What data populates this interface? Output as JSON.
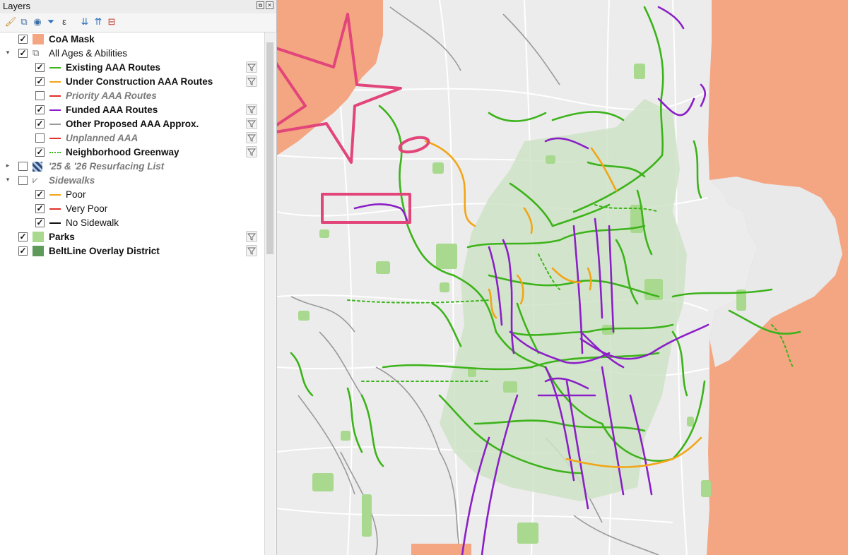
{
  "panel": {
    "title": "Layers",
    "layers": [
      {
        "label": "CoA Mask",
        "checked": true,
        "symbol": "fill",
        "color": "#f4a582",
        "style": "bold",
        "filter": false
      },
      {
        "label": "All Ages & Abilities",
        "checked": true,
        "symbol": "group",
        "style": "normal",
        "filter": false,
        "expanded": true
      },
      {
        "label": "Existing AAA Routes",
        "checked": true,
        "symbol": "line",
        "color": "#3cb31a",
        "style": "bold",
        "filter": true
      },
      {
        "label": "Under Construction AAA Routes",
        "checked": true,
        "symbol": "line",
        "color": "#f2a516",
        "style": "bold",
        "filter": true
      },
      {
        "label": "Priority AAA Routes",
        "checked": false,
        "symbol": "line",
        "color": "#e0302a",
        "style": "gray-it",
        "filter": false
      },
      {
        "label": "Funded AAA Routes",
        "checked": true,
        "symbol": "line",
        "color": "#8b1fc7",
        "style": "bold",
        "filter": true
      },
      {
        "label": "Other Proposed AAA Approx.",
        "checked": true,
        "symbol": "line",
        "color": "#9a9a9a",
        "style": "bold",
        "filter": true
      },
      {
        "label": "Unplanned AAA",
        "checked": false,
        "symbol": "line",
        "color": "#e0302a",
        "style": "gray-it",
        "filter": true
      },
      {
        "label": "Neighborhood Greenway",
        "checked": true,
        "symbol": "dotted",
        "color": "#3cb31a",
        "style": "bold",
        "filter": true
      },
      {
        "label": "'25 & '26 Resurfacing List",
        "checked": false,
        "symbol": "raster",
        "style": "gray-it",
        "filter": false,
        "expanded": false
      },
      {
        "label": "Sidewalks",
        "checked": false,
        "symbol": "sidewalk-group",
        "style": "gray-it",
        "filter": false,
        "expanded": true
      },
      {
        "label": "Poor",
        "checked": true,
        "symbol": "line",
        "color": "#f2a516",
        "style": "normal",
        "filter": false
      },
      {
        "label": "Very Poor",
        "checked": true,
        "symbol": "line",
        "color": "#e0302a",
        "style": "normal",
        "filter": false
      },
      {
        "label": "No Sidewalk",
        "checked": true,
        "symbol": "line",
        "color": "#111111",
        "style": "normal",
        "filter": false
      },
      {
        "label": "Parks",
        "checked": true,
        "symbol": "fill",
        "color": "#a8d98e",
        "style": "bold",
        "filter": true
      },
      {
        "label": "BeltLine Overlay District",
        "checked": true,
        "symbol": "fill",
        "color": "#5e9a5a",
        "style": "bold",
        "filter": true
      }
    ]
  },
  "toolbar_icons": [
    "style-manager-icon",
    "add-group-icon",
    "visibility-eye-icon",
    "filter-legend-icon",
    "expression-filter-icon",
    "expand-all-icon",
    "collapse-all-icon",
    "remove-layer-icon"
  ],
  "map": {
    "colors": {
      "mask": "#f4a582",
      "existing": "#3cb31a",
      "under_construction": "#f2a516",
      "funded": "#8b1fc7",
      "proposed": "#9a9a9a",
      "greenway": "#3cb31a",
      "park": "#a8d98e",
      "beltline": "#cfe3c7",
      "annotation": "#e2457a"
    }
  }
}
